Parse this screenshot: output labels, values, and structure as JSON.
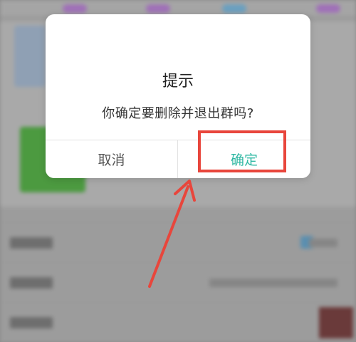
{
  "dialog": {
    "title": "提示",
    "message": "你确定要删除并退出群吗?",
    "cancel_label": "取消",
    "confirm_label": "确定"
  },
  "colors": {
    "confirm_text": "#2fb8a3",
    "annotation": "#e8463c",
    "overlay": "#8a8a8a"
  },
  "icons": {
    "annotation_arrow": "arrow-pointing-up-right"
  }
}
